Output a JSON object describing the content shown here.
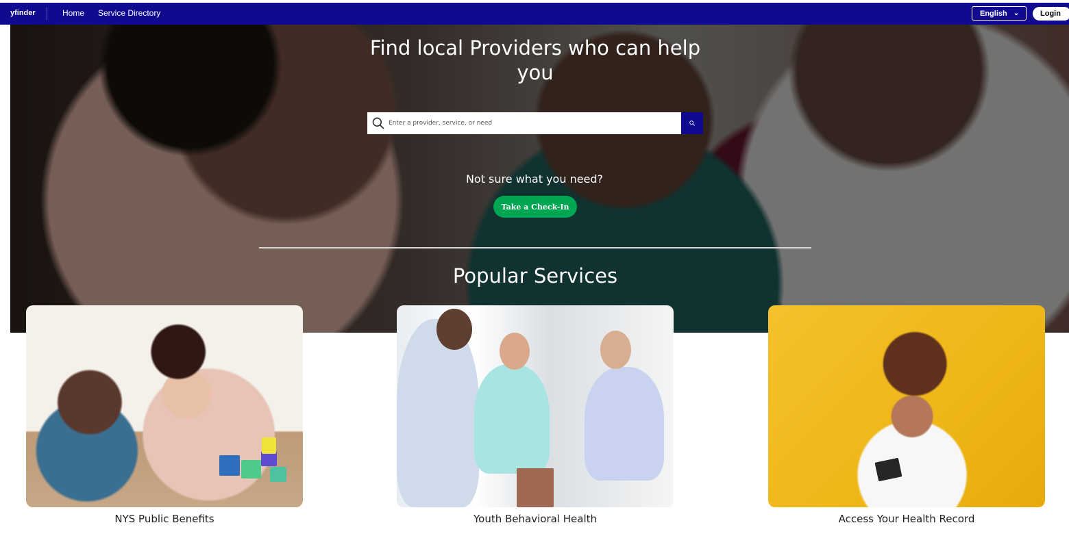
{
  "nav": {
    "brand": "yfinder",
    "home": "Home",
    "service_directory": "Service Directory",
    "language": "English",
    "login": "Login"
  },
  "hero": {
    "title": "Find local Providers who can help you",
    "search_placeholder": "Enter a provider, service, or need",
    "not_sure": "Not sure what you need?",
    "checkin": "Take a Check-In",
    "popular_services": "Popular Services"
  },
  "services": [
    {
      "label": "NYS Public Benefits"
    },
    {
      "label": "Youth Behavioral Health"
    },
    {
      "label": "Access Your Health Record"
    }
  ],
  "colors": {
    "navy": "#0f0a8f",
    "green": "#00a651",
    "white": "#ffffff"
  }
}
